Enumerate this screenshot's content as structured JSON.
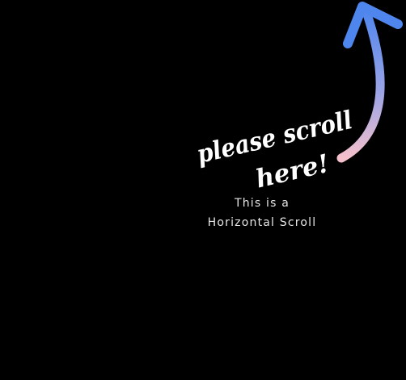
{
  "screen": {
    "background": "#000000"
  },
  "hint": {
    "line1": "please scroll",
    "line2": "here!",
    "color": "#ffffff"
  },
  "arrow": {
    "icon": "curved-arrow-up-icon",
    "gradient_top": "#4f86ee",
    "gradient_bottom": "#f4c0cc"
  },
  "caption": {
    "line1": "This is a",
    "line2": "Horizontal Scroll",
    "color": "#e6e6e6"
  }
}
